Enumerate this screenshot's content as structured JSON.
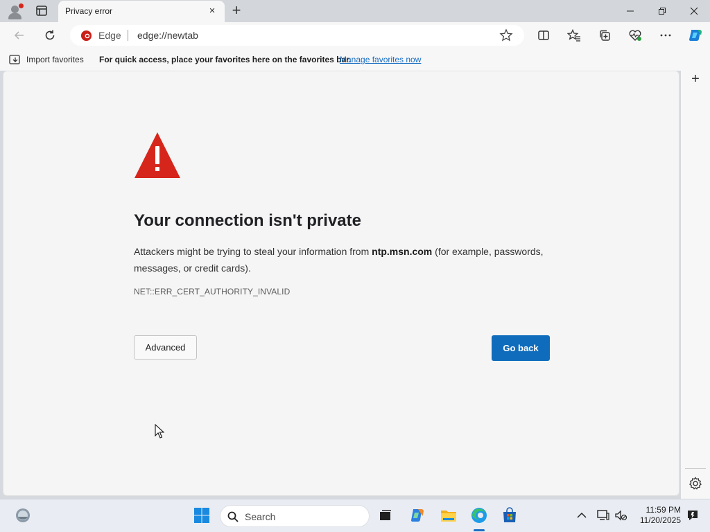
{
  "window": {
    "tab_title": "Privacy error",
    "tab_close": "×",
    "new_tab": "+"
  },
  "address_bar": {
    "scheme_label": "Edge",
    "url": "edge://newtab"
  },
  "favorites_bar": {
    "import_label": "Import favorites",
    "message": "For quick access, place your favorites here on the favorites bar.",
    "manage_link": "Manage favorites now"
  },
  "error_page": {
    "heading": "Your connection isn't private",
    "desc_before": "Attackers might be trying to steal your information from ",
    "desc_host": "ntp.msn.com",
    "desc_after": " (for example, passwords, messages, or credit cards).",
    "error_code": "NET::ERR_CERT_AUTHORITY_INVALID",
    "advanced_button": "Advanced",
    "back_button": "Go back"
  },
  "taskbar": {
    "search_placeholder": "Search",
    "time": "11:59 PM",
    "date": "11/20/2025"
  },
  "colors": {
    "accent": "#0f6cbd",
    "warning_red": "#d6261c",
    "link": "#1a6fc4"
  },
  "icons": [
    "profile-icon",
    "tab-actions-icon",
    "back-icon",
    "refresh-icon",
    "edge-icon",
    "favorite-star-icon",
    "split-screen-icon",
    "favorites-icon",
    "collections-icon",
    "browser-essentials-icon",
    "more-icon",
    "copilot-icon",
    "warning-triangle-icon",
    "settings-gear-icon",
    "windows-start-icon",
    "search-icon",
    "file-explorer-icon",
    "store-icon"
  ]
}
